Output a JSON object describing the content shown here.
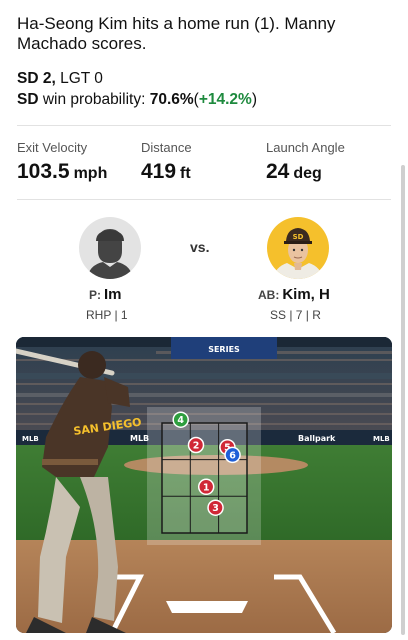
{
  "play": {
    "headline": "Ha-Seong Kim hits a home run (1). Manny Machado scores."
  },
  "score": {
    "lead_team": "SD",
    "lead_runs": "2,",
    "other_team": "LGT",
    "other_runs": "0"
  },
  "win_probability": {
    "team": "SD",
    "label": "win probability:",
    "value": "70.6%",
    "change": "+14.2%"
  },
  "stats": [
    {
      "label": "Exit Velocity",
      "value": "103.5",
      "unit": "mph"
    },
    {
      "label": "Distance",
      "value": "419",
      "unit": "ft"
    },
    {
      "label": "Launch Angle",
      "value": "24",
      "unit": "deg"
    }
  ],
  "matchup": {
    "vs_label": "vs.",
    "pitcher": {
      "prefix": "P:",
      "name": "Im",
      "details": "RHP | 1"
    },
    "batter": {
      "prefix": "AB:",
      "name": "Kim, H",
      "details": "SS | 7 | R"
    }
  },
  "scene": {
    "banner_text": "SERIES",
    "wall_ads": [
      "MLB",
      "MLB",
      "Ballpark",
      "MLB"
    ],
    "jersey_text": "SAN DIEGO"
  },
  "pitches": [
    {
      "number": "1",
      "type": "strike",
      "h": 0.52,
      "v": 0.58
    },
    {
      "number": "2",
      "type": "strike",
      "h": 0.4,
      "v": 0.2
    },
    {
      "number": "3",
      "type": "strike",
      "h": 0.63,
      "v": 0.77
    },
    {
      "number": "4",
      "type": "ball",
      "h": 0.22,
      "v": -0.03
    },
    {
      "number": "5",
      "type": "strike",
      "h": 0.77,
      "v": 0.22
    },
    {
      "number": "6",
      "type": "in-play",
      "h": 0.83,
      "v": 0.29
    }
  ],
  "colors": {
    "strike": "#d02736",
    "ball": "#2e9e3e",
    "in_play": "#1f5fd8",
    "positive": "#1e8a3e",
    "padres_gold": "#f5c02c"
  }
}
